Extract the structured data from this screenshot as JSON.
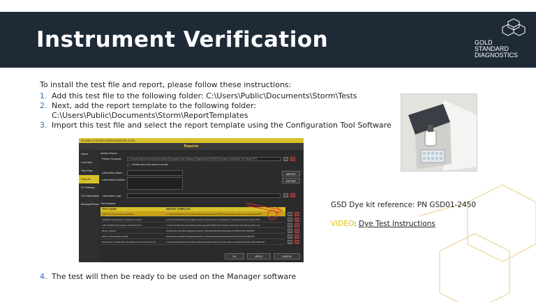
{
  "header": {
    "title": "Instrument Verification",
    "logo_lines": [
      "GOLD",
      "STANDARD",
      "DIAGNOSTICS"
    ]
  },
  "instructions": {
    "intro": "To install the test file and report, please follow these instructions:",
    "steps": [
      {
        "num": "1.",
        "text": "Add this test file to the following folder: C:\\Users\\Public\\Documents\\Storm\\Tests"
      },
      {
        "num": "2.",
        "text": "Next, add the report template to the following folder: C:\\Users\\Public\\Documents\\Storm\\ReportTemplates"
      },
      {
        "num": "3.",
        "text": "Import this test file and select the report template using the Configuration Tool Software"
      }
    ],
    "step4": {
      "num": "4.",
      "text": "The test will then be ready to be used on the Manager software"
    }
  },
  "reference": {
    "dye_kit": "GSD Dye kit reference: PN GSD01-2450",
    "video_tag": "VIDEO",
    "video_sep": ":",
    "video_link": "Dye Test Instructions"
  },
  "app": {
    "window_title": "STORM SYSTEM CONFIGURATION TOOL",
    "heading": "Reports",
    "sidebar": [
      {
        "label": "Users",
        "active": false
      },
      {
        "label": "Licenses",
        "active": false
      },
      {
        "label": "Test Files",
        "active": false
      },
      {
        "label": "Reports",
        "active": true
      },
      {
        "label": "UI Settings",
        "active": false
      },
      {
        "label": "LIS Associations",
        "active": false
      },
      {
        "label": "Backup/Restore",
        "active": false
      }
    ],
    "section_label": "Modify Report",
    "report_template_label": "Report Template",
    "report_template_value": "C:\\Users\\Public\\Documents\\Storm\\ReportTemplates\\Gold Standard Diagnostics\\STORM Performance Verification Test Report.RPT",
    "checkbox_label": "Delete drop test reports by test",
    "lab_name_label": "Laboratory Name",
    "lab_address_label": "Laboratory Address",
    "lab_logo_label": "Laboratory Logo",
    "import_button": "IMPORT",
    "export_button": "EXPORT",
    "test_reports_label": "Test Reports",
    "table_headers": [
      "TEST NAME",
      "REPORT TEMPLATE"
    ],
    "rows": [
      [
        "GSD Dye Performance Verification",
        "C:\\Users\\Public\\Documents\\Storm\\ReportTemplates\\STORM Performance Verification Test Report.RPT"
      ],
      [
        "GSD2021 Performance Verification Reader",
        "Level2 STORM Report Template STR1.11 Performance Verification for Students Retrieve.Report.RPT"
      ],
      [
        "GTS STORM Performance Verification ITS",
        "C:\\Users\\Public\\Documents\\ReportTemplates\\STORM Performance Verification Test Report SR-m.rpt"
      ],
      [
        "Mouse, Reactor",
        "s/Files\\Gold Standard Diagnostics\\Storm Suite\\Default\\Reports\\Default STORM FAST REPORT"
      ],
      [
        "Mouse, Microcephaly ACIDA",
        "s/Files\\Gold Standard Diagnostics\\Storm Suite\\Default\\Reports\\Default STORM FAST REPORT"
      ],
      [
        "Mycoplasma, Chlamydia, Ureaplasma, Gonococcus ICCS",
        "C:\\Users\\Public\\Documents\\ReportTemplates\\Mycoplasma_Chlamydia_Feedback\\STORM FAST REPORT"
      ]
    ],
    "ok_button": "OK",
    "apply_button": "APPLY",
    "cancel_button": "CANCEL",
    "minibtn_dots": "...",
    "minibtn_x": "×"
  },
  "colors": {
    "header_bg": "#1f2a37",
    "accent_yellow": "#d8c02a",
    "step_number_blue": "#2a6db5",
    "deco_gold": "#f0dcae"
  }
}
